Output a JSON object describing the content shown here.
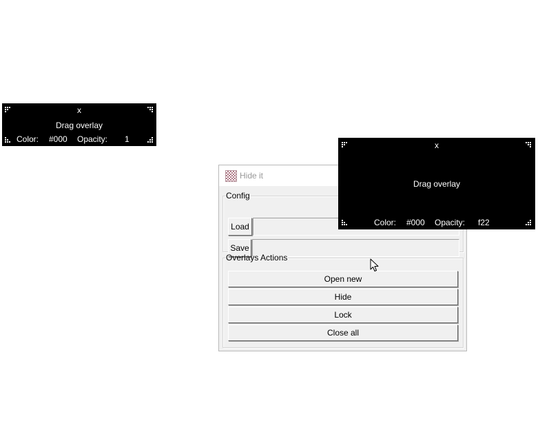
{
  "main_window": {
    "title": "Hide it",
    "config": {
      "legend": "Config",
      "load_label": "Load",
      "save_label": "Save",
      "load_path": "",
      "save_path": ""
    },
    "overlays_actions": {
      "legend": "Overlays Actions",
      "buttons": [
        "Open new",
        "Hide",
        "Lock",
        "Close all"
      ]
    }
  },
  "overlays": [
    {
      "close_label": "x",
      "drag_label": "Drag overlay",
      "color_label": "Color:",
      "color_value": "#000",
      "opacity_label": "Opacity:",
      "opacity_value": "1"
    },
    {
      "close_label": "x",
      "drag_label": "Drag overlay",
      "color_label": "Color:",
      "color_value": "#000",
      "opacity_label": "Opacity:",
      "opacity_value": "f22"
    }
  ],
  "colors": {
    "overlay_background": "#000000",
    "overlay_text": "#ffffff",
    "window_background": "#f0f0f0",
    "title_text_inactive": "#999999"
  }
}
